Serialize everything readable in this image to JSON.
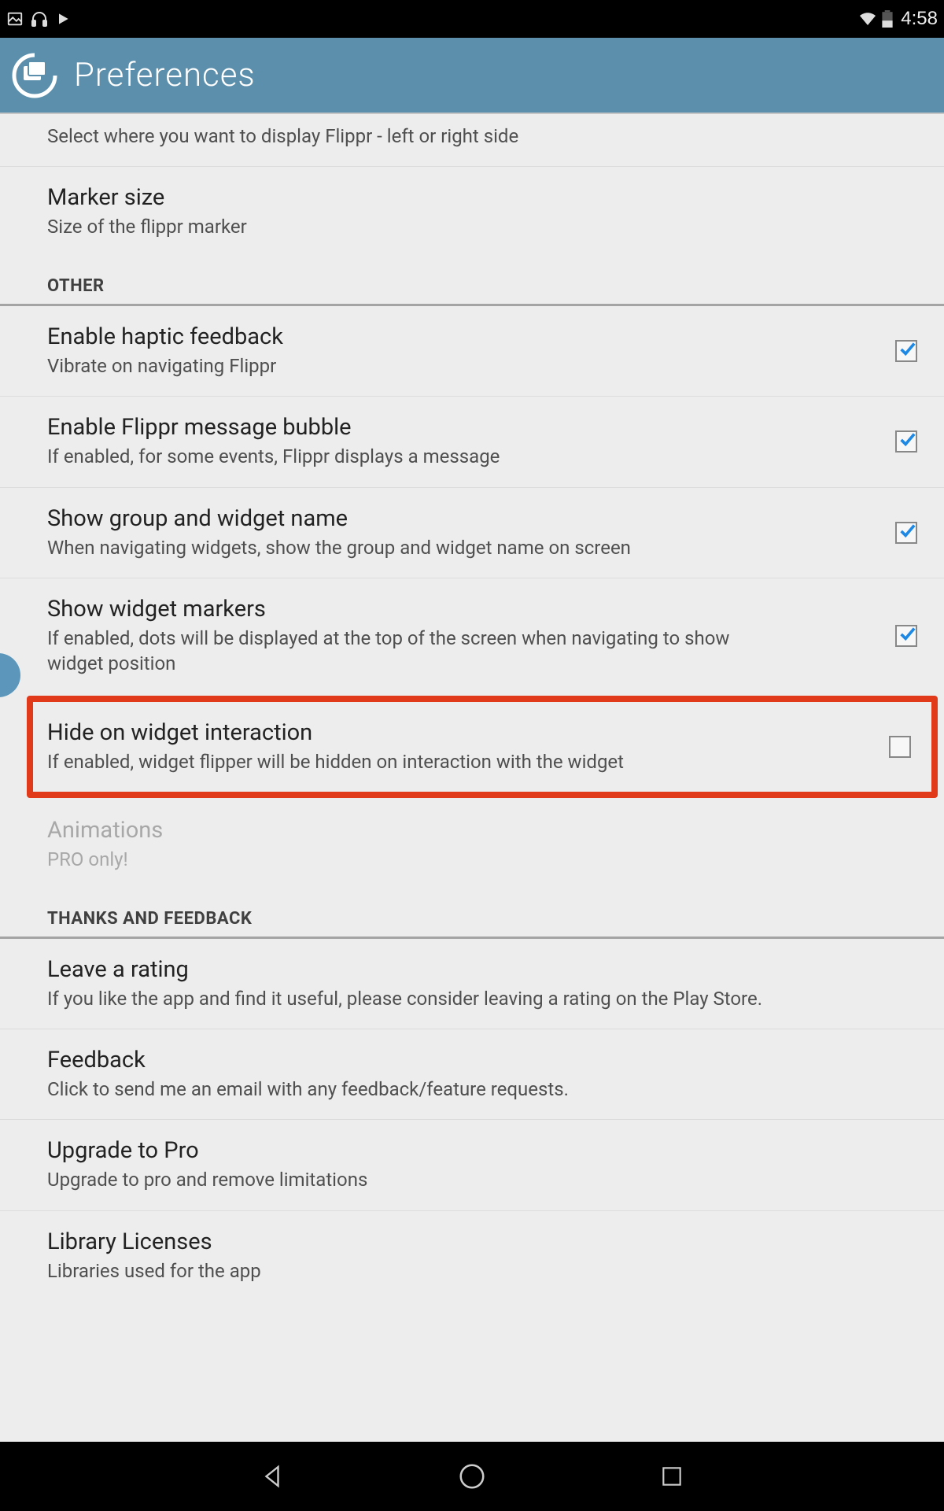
{
  "status": {
    "time": "4:58"
  },
  "app": {
    "title": "Preferences"
  },
  "items": {
    "location": {
      "summary": "Select where you want to display Flippr - left or right side"
    },
    "marker": {
      "title": "Marker size",
      "summary": "Size of the flippr marker"
    },
    "haptic": {
      "title": "Enable haptic feedback",
      "summary": "Vibrate on navigating Flippr",
      "checked": true
    },
    "bubble": {
      "title": "Enable Flippr message bubble",
      "summary": "If enabled, for some events, Flippr displays a message",
      "checked": true
    },
    "groupname": {
      "title": "Show group and widget name",
      "summary": "When navigating widgets, show the group and widget name on screen",
      "checked": true
    },
    "markers": {
      "title": "Show widget markers",
      "summary": "If enabled, dots will be displayed at the top of the screen when navigating to show widget position",
      "checked": true
    },
    "hide": {
      "title": "Hide on widget interaction",
      "summary": "If enabled, widget flipper will be hidden on interaction with the widget",
      "checked": false
    },
    "anim": {
      "title": "Animations",
      "summary": "PRO only!"
    },
    "rating": {
      "title": "Leave a rating",
      "summary": "If you like the app and find it useful, please consider leaving a rating on the Play Store."
    },
    "feedback": {
      "title": "Feedback",
      "summary": "Click to send me an email with any feedback/feature requests."
    },
    "upgrade": {
      "title": "Upgrade to Pro",
      "summary": "Upgrade to pro and remove limitations"
    },
    "libs": {
      "title": "Library Licenses",
      "summary": "Libraries used for the app"
    }
  },
  "sections": {
    "other": "OTHER",
    "thanks": "THANKS AND FEEDBACK"
  }
}
